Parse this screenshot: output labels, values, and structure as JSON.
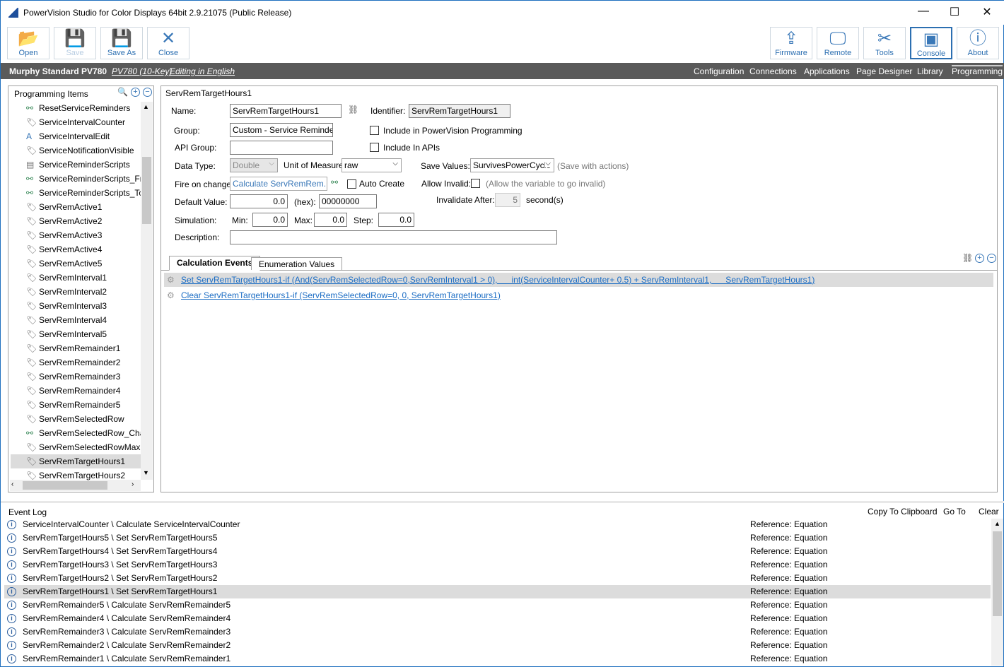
{
  "window": {
    "title": "PowerVision Studio for Color Displays 64bit 2.9.21075 (Public Release)",
    "min": "—",
    "max": "☐",
    "close": "✕"
  },
  "toolbar": {
    "left": [
      {
        "label": "Open",
        "icon": "folder-icon",
        "glyph": "📂"
      },
      {
        "label": "Save",
        "icon": "save-icon",
        "glyph": "💾",
        "disabled": true
      },
      {
        "label": "Save As",
        "icon": "save-as-icon",
        "glyph": "💾"
      },
      {
        "label": "Close",
        "icon": "close-icon",
        "glyph": "✕"
      }
    ],
    "right": [
      {
        "label": "Firmware",
        "icon": "upload-icon",
        "glyph": "⇪"
      },
      {
        "label": "Remote",
        "icon": "monitor-icon",
        "glyph": "🖵"
      },
      {
        "label": "Tools",
        "icon": "tools-icon",
        "glyph": "✂"
      },
      {
        "label": "Console",
        "icon": "console-icon",
        "glyph": "▣",
        "selected": true
      },
      {
        "label": "About",
        "icon": "info-icon",
        "glyph": "ⓘ"
      }
    ]
  },
  "project": {
    "name": "Murphy Standard PV780",
    "device": "PV780 (10-Key)",
    "language": "Editing in English"
  },
  "nav": [
    "Configuration",
    "Connections",
    "Applications",
    "Page Designer",
    "Library",
    "Programming"
  ],
  "nav_active": "Programming",
  "tree": {
    "header": "Programming Items",
    "items": [
      {
        "label": "ResetServiceReminders",
        "icon": "script-icon"
      },
      {
        "label": "ServiceIntervalCounter",
        "icon": "variable-icon"
      },
      {
        "label": "ServiceIntervalEdit",
        "icon": "text-icon"
      },
      {
        "label": "ServiceNotificationVisible",
        "icon": "variable-icon"
      },
      {
        "label": "ServiceReminderScripts",
        "icon": "script-list-icon"
      },
      {
        "label": "ServiceReminderScripts_From",
        "icon": "script-icon"
      },
      {
        "label": "ServiceReminderScripts_ToK",
        "icon": "script-icon"
      },
      {
        "label": "ServRemActive1",
        "icon": "variable-icon"
      },
      {
        "label": "ServRemActive2",
        "icon": "variable-icon"
      },
      {
        "label": "ServRemActive3",
        "icon": "variable-icon"
      },
      {
        "label": "ServRemActive4",
        "icon": "variable-icon"
      },
      {
        "label": "ServRemActive5",
        "icon": "variable-icon"
      },
      {
        "label": "ServRemInterval1",
        "icon": "variable-icon"
      },
      {
        "label": "ServRemInterval2",
        "icon": "variable-icon"
      },
      {
        "label": "ServRemInterval3",
        "icon": "variable-icon"
      },
      {
        "label": "ServRemInterval4",
        "icon": "variable-icon"
      },
      {
        "label": "ServRemInterval5",
        "icon": "variable-icon"
      },
      {
        "label": "ServRemRemainder1",
        "icon": "variable-icon"
      },
      {
        "label": "ServRemRemainder2",
        "icon": "variable-icon"
      },
      {
        "label": "ServRemRemainder3",
        "icon": "variable-icon"
      },
      {
        "label": "ServRemRemainder4",
        "icon": "variable-icon"
      },
      {
        "label": "ServRemRemainder5",
        "icon": "variable-icon"
      },
      {
        "label": "ServRemSelectedRow",
        "icon": "variable-icon"
      },
      {
        "label": "ServRemSelectedRow_Chan",
        "icon": "script-icon"
      },
      {
        "label": "ServRemSelectedRowMax",
        "icon": "variable-icon"
      },
      {
        "label": "ServRemTargetHours1",
        "icon": "variable-icon",
        "selected": true
      },
      {
        "label": "ServRemTargetHours2",
        "icon": "variable-icon"
      }
    ]
  },
  "form": {
    "heading": "ServRemTargetHours1",
    "name_label": "Name:",
    "name": "ServRemTargetHours1",
    "identifier_label": "Identifier:",
    "identifier": "ServRemTargetHours1",
    "group_label": "Group:",
    "group": "Custom - Service Reminders",
    "include_pv_label": "Include in PowerVision Programming",
    "include_api_label": "Include In APIs",
    "api_group_label": "API Group:",
    "api_group": "",
    "data_type_label": "Data Type:",
    "data_type": "Double",
    "uom_label": "Unit of Measure:",
    "uom": "raw",
    "save_values_label": "Save Values:",
    "save_values": "SurvivesPowerCycle",
    "save_hint": "(Save with actions)",
    "fire_label": "Fire on change:",
    "fire": "Calculate ServRemRem...",
    "auto_create_label": "Auto Create",
    "allow_invalid_label": "Allow Invalid:",
    "allow_invalid_hint": "(Allow the variable to go invalid)",
    "default_label": "Default Value:",
    "default": "0.0",
    "hex_label": "(hex):",
    "hex": "00000000",
    "invalidate_label": "Invalidate After:",
    "invalidate": "5",
    "invalidate_unit": "second(s)",
    "sim_label": "Simulation:",
    "min_label": "Min:",
    "min": "0.0",
    "max_label": "Max:",
    "max": "0.0",
    "step_label": "Step:",
    "step": "0.0",
    "desc_label": "Description:",
    "desc": ""
  },
  "tabs": [
    "Calculation Events",
    "Enumeration Values"
  ],
  "events": [
    "Set ServRemTargetHours1-if (And(ServRemSelectedRow=0,ServRemInterval1 > 0),      int(ServiceIntervalCounter+ 0.5) + ServRemInterval1,      ServRemTargetHours1)",
    "Clear ServRemTargetHours1-if (ServRemSelectedRow=0, 0, ServRemTargetHours1)"
  ],
  "log": {
    "title": "Event Log",
    "actions": [
      "Copy To Clipboard",
      "Go To",
      "Clear"
    ],
    "rows": [
      {
        "m": "ServiceIntervalCounter \\ Calculate ServiceIntervalCounter",
        "r": "Reference: Equation"
      },
      {
        "m": "ServRemTargetHours5 \\ Set ServRemTargetHours5",
        "r": "Reference: Equation"
      },
      {
        "m": "ServRemTargetHours4 \\ Set ServRemTargetHours4",
        "r": "Reference: Equation"
      },
      {
        "m": "ServRemTargetHours3 \\ Set ServRemTargetHours3",
        "r": "Reference: Equation"
      },
      {
        "m": "ServRemTargetHours2 \\ Set ServRemTargetHours2",
        "r": "Reference: Equation"
      },
      {
        "m": "ServRemTargetHours1 \\ Set ServRemTargetHours1",
        "r": "Reference: Equation",
        "selected": true
      },
      {
        "m": "ServRemRemainder5 \\ Calculate ServRemRemainder5",
        "r": "Reference: Equation"
      },
      {
        "m": "ServRemRemainder4 \\ Calculate ServRemRemainder4",
        "r": "Reference: Equation"
      },
      {
        "m": "ServRemRemainder3 \\ Calculate ServRemRemainder3",
        "r": "Reference: Equation"
      },
      {
        "m": "ServRemRemainder2 \\ Calculate ServRemRemainder2",
        "r": "Reference: Equation"
      },
      {
        "m": "ServRemRemainder1 \\ Calculate ServRemRemainder1",
        "r": "Reference: Equation"
      }
    ]
  }
}
